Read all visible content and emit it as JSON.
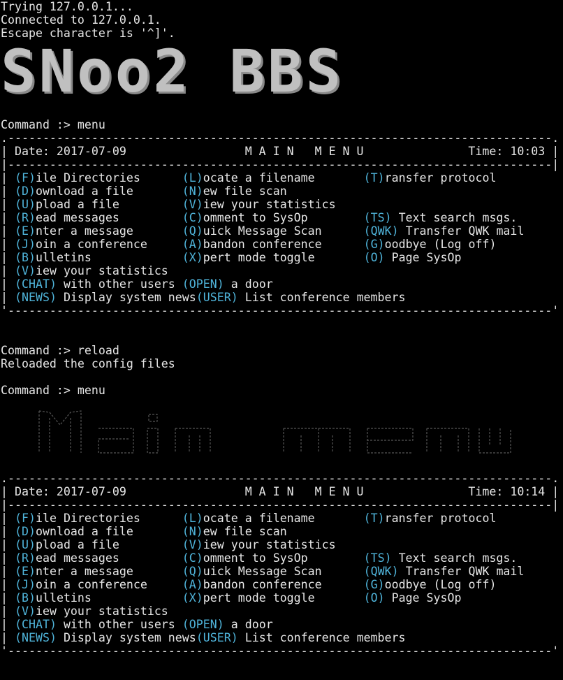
{
  "session": {
    "line1": "Trying 127.0.0.1...",
    "line2": "Connected to 127.0.0.1.",
    "line3": "Escape character is '^]'."
  },
  "banner": {
    "text": "SNoo2 BBS"
  },
  "commands": {
    "prompt": "Command :> ",
    "cmd1": "menu",
    "cmd2": "reload",
    "reload_msg": "Reloaded the config files",
    "cmd3": "menu"
  },
  "banner2": {
    "text": "Main menu"
  },
  "menu1": {
    "date": "Date: 2017-07-09",
    "title": "M A I N   M E N U",
    "time": "Time: 10:03"
  },
  "menu2": {
    "date": "Date: 2017-07-09",
    "title": "M A I N   M E N U",
    "time": "Time: 10:14"
  },
  "items": {
    "file_key": "F",
    "file_rest": "ile Directories",
    "locate_key": "L",
    "locate_rest": "ocate a filename",
    "transfer_key": "T",
    "transfer_rest": "ransfer protocol",
    "download_key": "D",
    "download_rest": "ownload a file",
    "newscan_key": "N",
    "newscan_rest": "ew file scan",
    "upload_key": "U",
    "upload_rest": "pload a file",
    "viewstats_key": "V",
    "viewstats_rest": "iew your statistics",
    "read_key": "R",
    "read_rest": "ead messages",
    "comment_key": "C",
    "comment_rest": "omment to SysOp",
    "ts_key": "TS",
    "ts_rest": " Text search msgs.",
    "enter_key": "E",
    "enter_rest": "nter a message",
    "quick_key": "Q",
    "quick_rest": "uick Message Scan",
    "qwk_key": "QWK",
    "qwk_rest": " Transfer QWK mail",
    "join_key": "J",
    "join_rest": "oin a conference",
    "abandon_key": "A",
    "abandon_rest": "bandon conference",
    "goodbye_key": "G",
    "goodbye_rest": "oodbye (Log off)",
    "bulletins_key": "B",
    "bulletins_rest": "ulletins",
    "xpert_key": "X",
    "xpert_rest": "pert mode toggle",
    "page_key": "O",
    "page_rest": " Page SysOp",
    "view2_key": "V",
    "view2_rest": "iew your statistics",
    "chat_key": "CHAT",
    "chat_rest": " with other users ",
    "open_key": "OPEN",
    "open_rest": " a door",
    "news_key": "NEWS",
    "news_rest": " Display system news",
    "user_key": "USER",
    "user_rest": " List conference members"
  },
  "colors": {
    "key": "#4fb3d9",
    "text": "#e6e6e6",
    "bg": "#000000"
  }
}
